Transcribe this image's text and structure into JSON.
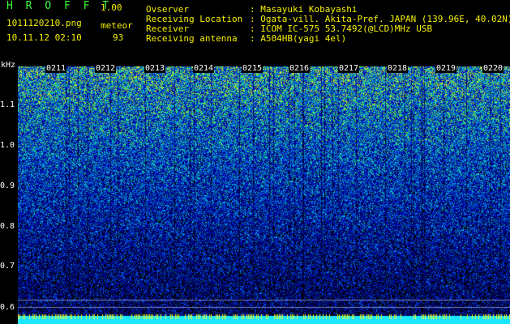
{
  "header": {
    "title": "H R O F F T",
    "version": "1.00",
    "filename": "1011120210.png",
    "meteor_label": "meteor",
    "datetime": "10.11.12 02:10",
    "meteor_count": "93"
  },
  "info": [
    {
      "label": "Ovserver",
      "value": ": Masayuki Kobayashi"
    },
    {
      "label": "Receiving Location",
      "value": ": Ogata-vill. Akita-Pref. JAPAN (139.96E, 40.02N)"
    },
    {
      "label": "Receiver",
      "value": ": ICOM IC-575 53.7492(@LCD)MHz USB"
    },
    {
      "label": "Receiving antenna",
      "value": ": A504HB(yagi 4el)"
    }
  ],
  "y_axis": {
    "unit": "kHz",
    "ticks": [
      "1.1",
      "1.0",
      "0.9",
      "0.8",
      "0.7",
      "0.6"
    ]
  },
  "x_axis": {
    "ticks": [
      "0211",
      "0212",
      "0213",
      "0214",
      "0215",
      "0216",
      "0217",
      "0218",
      "0219",
      "0220"
    ]
  }
}
